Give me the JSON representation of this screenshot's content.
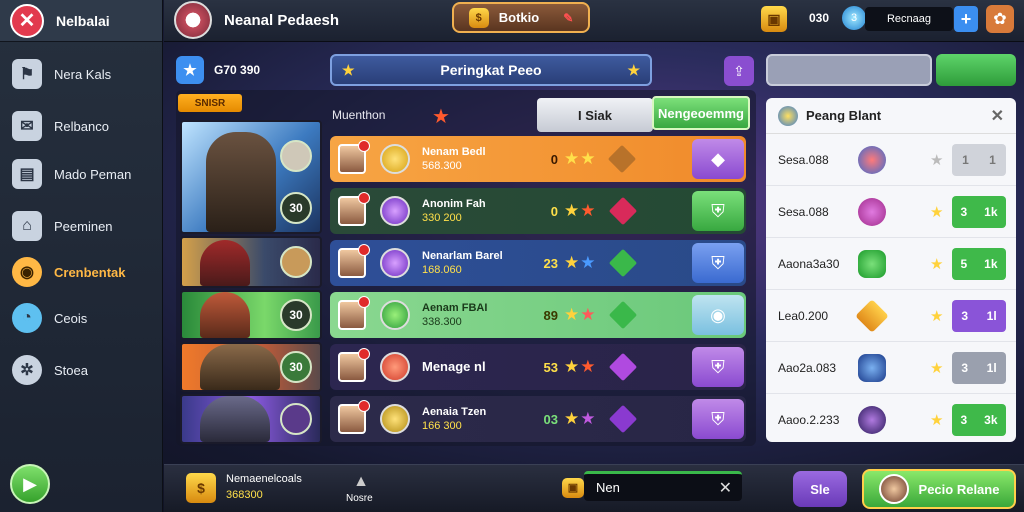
{
  "sidebar": {
    "title": "Nelbalai",
    "items": [
      {
        "label": "Nera Kals",
        "icon": "flag-icon"
      },
      {
        "label": "Relbanco",
        "icon": "mail-icon"
      },
      {
        "label": "Mado Peman",
        "icon": "card-icon"
      },
      {
        "label": "Peeminen",
        "icon": "gift-icon"
      },
      {
        "label": "Crenbentak",
        "icon": "globe-icon"
      },
      {
        "label": "Ceois",
        "icon": "chat-icon"
      },
      {
        "label": "Stoea",
        "icon": "gear-icon"
      }
    ]
  },
  "topbar": {
    "title": "Neanal Pedaesh",
    "center_label": "Botkio",
    "resource_value": "030",
    "resource_label": "Recnaag"
  },
  "header": {
    "score": "G70 390",
    "title": "Peringkat Peeo"
  },
  "panel": {
    "chip": "SNISR",
    "column_label": "Muenthon",
    "tab_inactive": "I Siak",
    "tab_active": "Nengeoemmg",
    "portrait_badges": [
      "",
      "30",
      "",
      "30",
      "30",
      ""
    ]
  },
  "rows": [
    {
      "name": "Nenam Bedl",
      "sub": "568.300",
      "rank": "0",
      "color": "#f59a2e"
    },
    {
      "name": "Anonim Fah",
      "sub": "330 200",
      "rank": "0",
      "color": "#2f5a3a"
    },
    {
      "name": "Nenarlam Barel",
      "sub": "168.060",
      "rank": "23",
      "color": "#2e4f98"
    },
    {
      "name": "Aenam FBAI",
      "sub": "338.300",
      "rank": "89",
      "color": "#7fcf86"
    },
    {
      "name": "Menage nl",
      "sub": "",
      "rank": "53",
      "color": "#2c2650"
    },
    {
      "name": "Aenaia Tzen",
      "sub": "166 300",
      "rank": "03",
      "color": "#2c2a4a"
    }
  ],
  "right_panel": {
    "title": "Peang Blant",
    "rows": [
      {
        "label": "Sesa.088",
        "v1": "1",
        "v2": "1",
        "btn_color": "#c8cbd2"
      },
      {
        "label": "Sesa.088",
        "v1": "3",
        "v2": "1k",
        "btn_color": "#3fb94a"
      },
      {
        "label": "Aaona3a30",
        "v1": "5",
        "v2": "1k",
        "btn_color": "#3fb94a"
      },
      {
        "label": "Lea0.200",
        "v1": "3",
        "v2": "1l",
        "btn_color": "#8a54d8"
      },
      {
        "label": "Aao2a.083",
        "v1": "3",
        "v2": "1l",
        "btn_color": "#9aa0ae"
      },
      {
        "label": "Aaoo.2.233",
        "v1": "3",
        "v2": "3k",
        "btn_color": "#3fb94a"
      }
    ]
  },
  "bottom": {
    "coins_label": "Nemaenelcoals",
    "coins_value": "368300",
    "mid_label": "Nosre",
    "field_label": "Nen",
    "small_btn": "Sle",
    "main_btn": "Pecio Relane"
  }
}
